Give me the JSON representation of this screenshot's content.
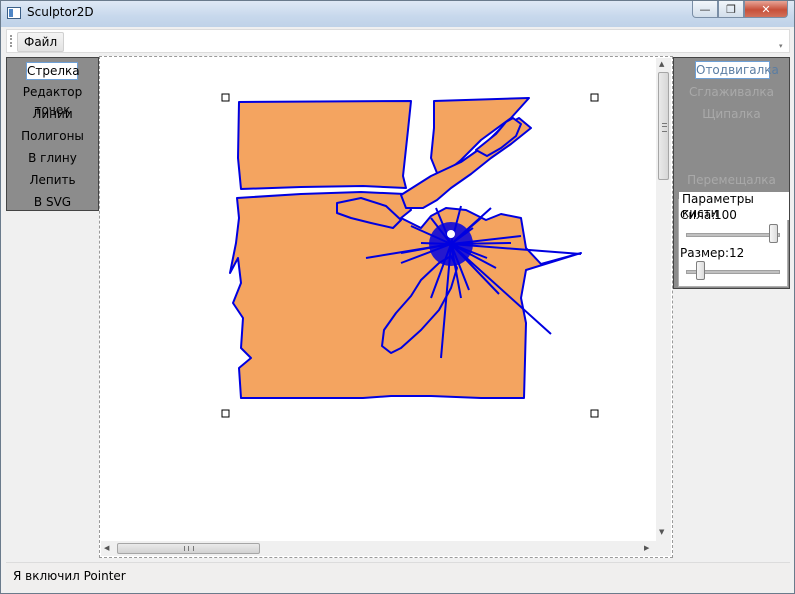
{
  "window": {
    "title": "Sculptor2D",
    "minimize": "—",
    "maximize": "❐",
    "close": "✕"
  },
  "menu": {
    "file_label": "Файл"
  },
  "left_tools": [
    {
      "label": "Стрелка",
      "active": true
    },
    {
      "label": "Редактор точек"
    },
    {
      "label": "Линии"
    },
    {
      "label": "Полигоны"
    },
    {
      "label": "В глину"
    },
    {
      "label": "Лепить"
    },
    {
      "label": "В SVG"
    }
  ],
  "right_tools": [
    {
      "label": "Отодвигалка",
      "active": true
    },
    {
      "label": "Сглаживалка"
    },
    {
      "label": "Щипалка"
    },
    {
      "label": "Перемещалка"
    }
  ],
  "brush": {
    "title": "Параметры кисти",
    "strength_label": "Сила:",
    "strength_value": "100",
    "size_label": "Размер:",
    "size_value": "12",
    "strength_fraction": 1.0,
    "size_fraction": 0.12
  },
  "canvas": {
    "shape_fill": "#f4a460",
    "shape_stroke": "#0000e0"
  },
  "status": {
    "text": "Я включил Pointer"
  }
}
